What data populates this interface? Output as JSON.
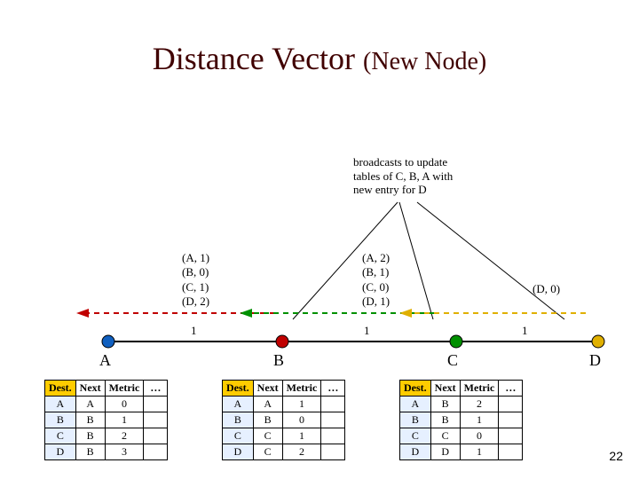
{
  "title_main": "Distance Vector",
  "title_sub": "(New Node)",
  "note_l1": "broadcasts to update",
  "note_l2": "tables of C, B, A with",
  "note_l3": "new entry for D",
  "vecB": [
    "(A, 1)",
    "(B, 0)",
    "(C, 1)",
    "(D, 2)"
  ],
  "vecC": [
    "(A, 2)",
    "(B, 1)",
    "(C, 0)",
    "(D, 1)"
  ],
  "vecD": "(D, 0)",
  "edge_AB": "1",
  "edge_BC": "1",
  "edge_CD": "1",
  "node_A": "A",
  "node_B": "B",
  "node_C": "C",
  "node_D": "D",
  "hdr": {
    "dest": "Dest.",
    "next": "Next",
    "metric": "Metric",
    "etc": "…"
  },
  "tableA": [
    {
      "d": "A",
      "n": "A",
      "m": "0"
    },
    {
      "d": "B",
      "n": "B",
      "m": "1"
    },
    {
      "d": "C",
      "n": "B",
      "m": "2"
    },
    {
      "d": "D",
      "n": "B",
      "m": "3"
    }
  ],
  "tableB": [
    {
      "d": "A",
      "n": "A",
      "m": "1"
    },
    {
      "d": "B",
      "n": "B",
      "m": "0"
    },
    {
      "d": "C",
      "n": "C",
      "m": "1"
    },
    {
      "d": "D",
      "n": "C",
      "m": "2"
    }
  ],
  "tableC": [
    {
      "d": "A",
      "n": "B",
      "m": "2"
    },
    {
      "d": "B",
      "n": "B",
      "m": "1"
    },
    {
      "d": "C",
      "n": "C",
      "m": "0"
    },
    {
      "d": "D",
      "n": "D",
      "m": "1"
    }
  ],
  "pagenum": "22",
  "colors": {
    "nodeA": "#1060c0",
    "nodeB": "#c00000",
    "nodeC": "#009000",
    "nodeD": "#e0b000",
    "arrowB": "#c00000",
    "arrowC": "#009000",
    "arrowD": "#e0b000"
  }
}
